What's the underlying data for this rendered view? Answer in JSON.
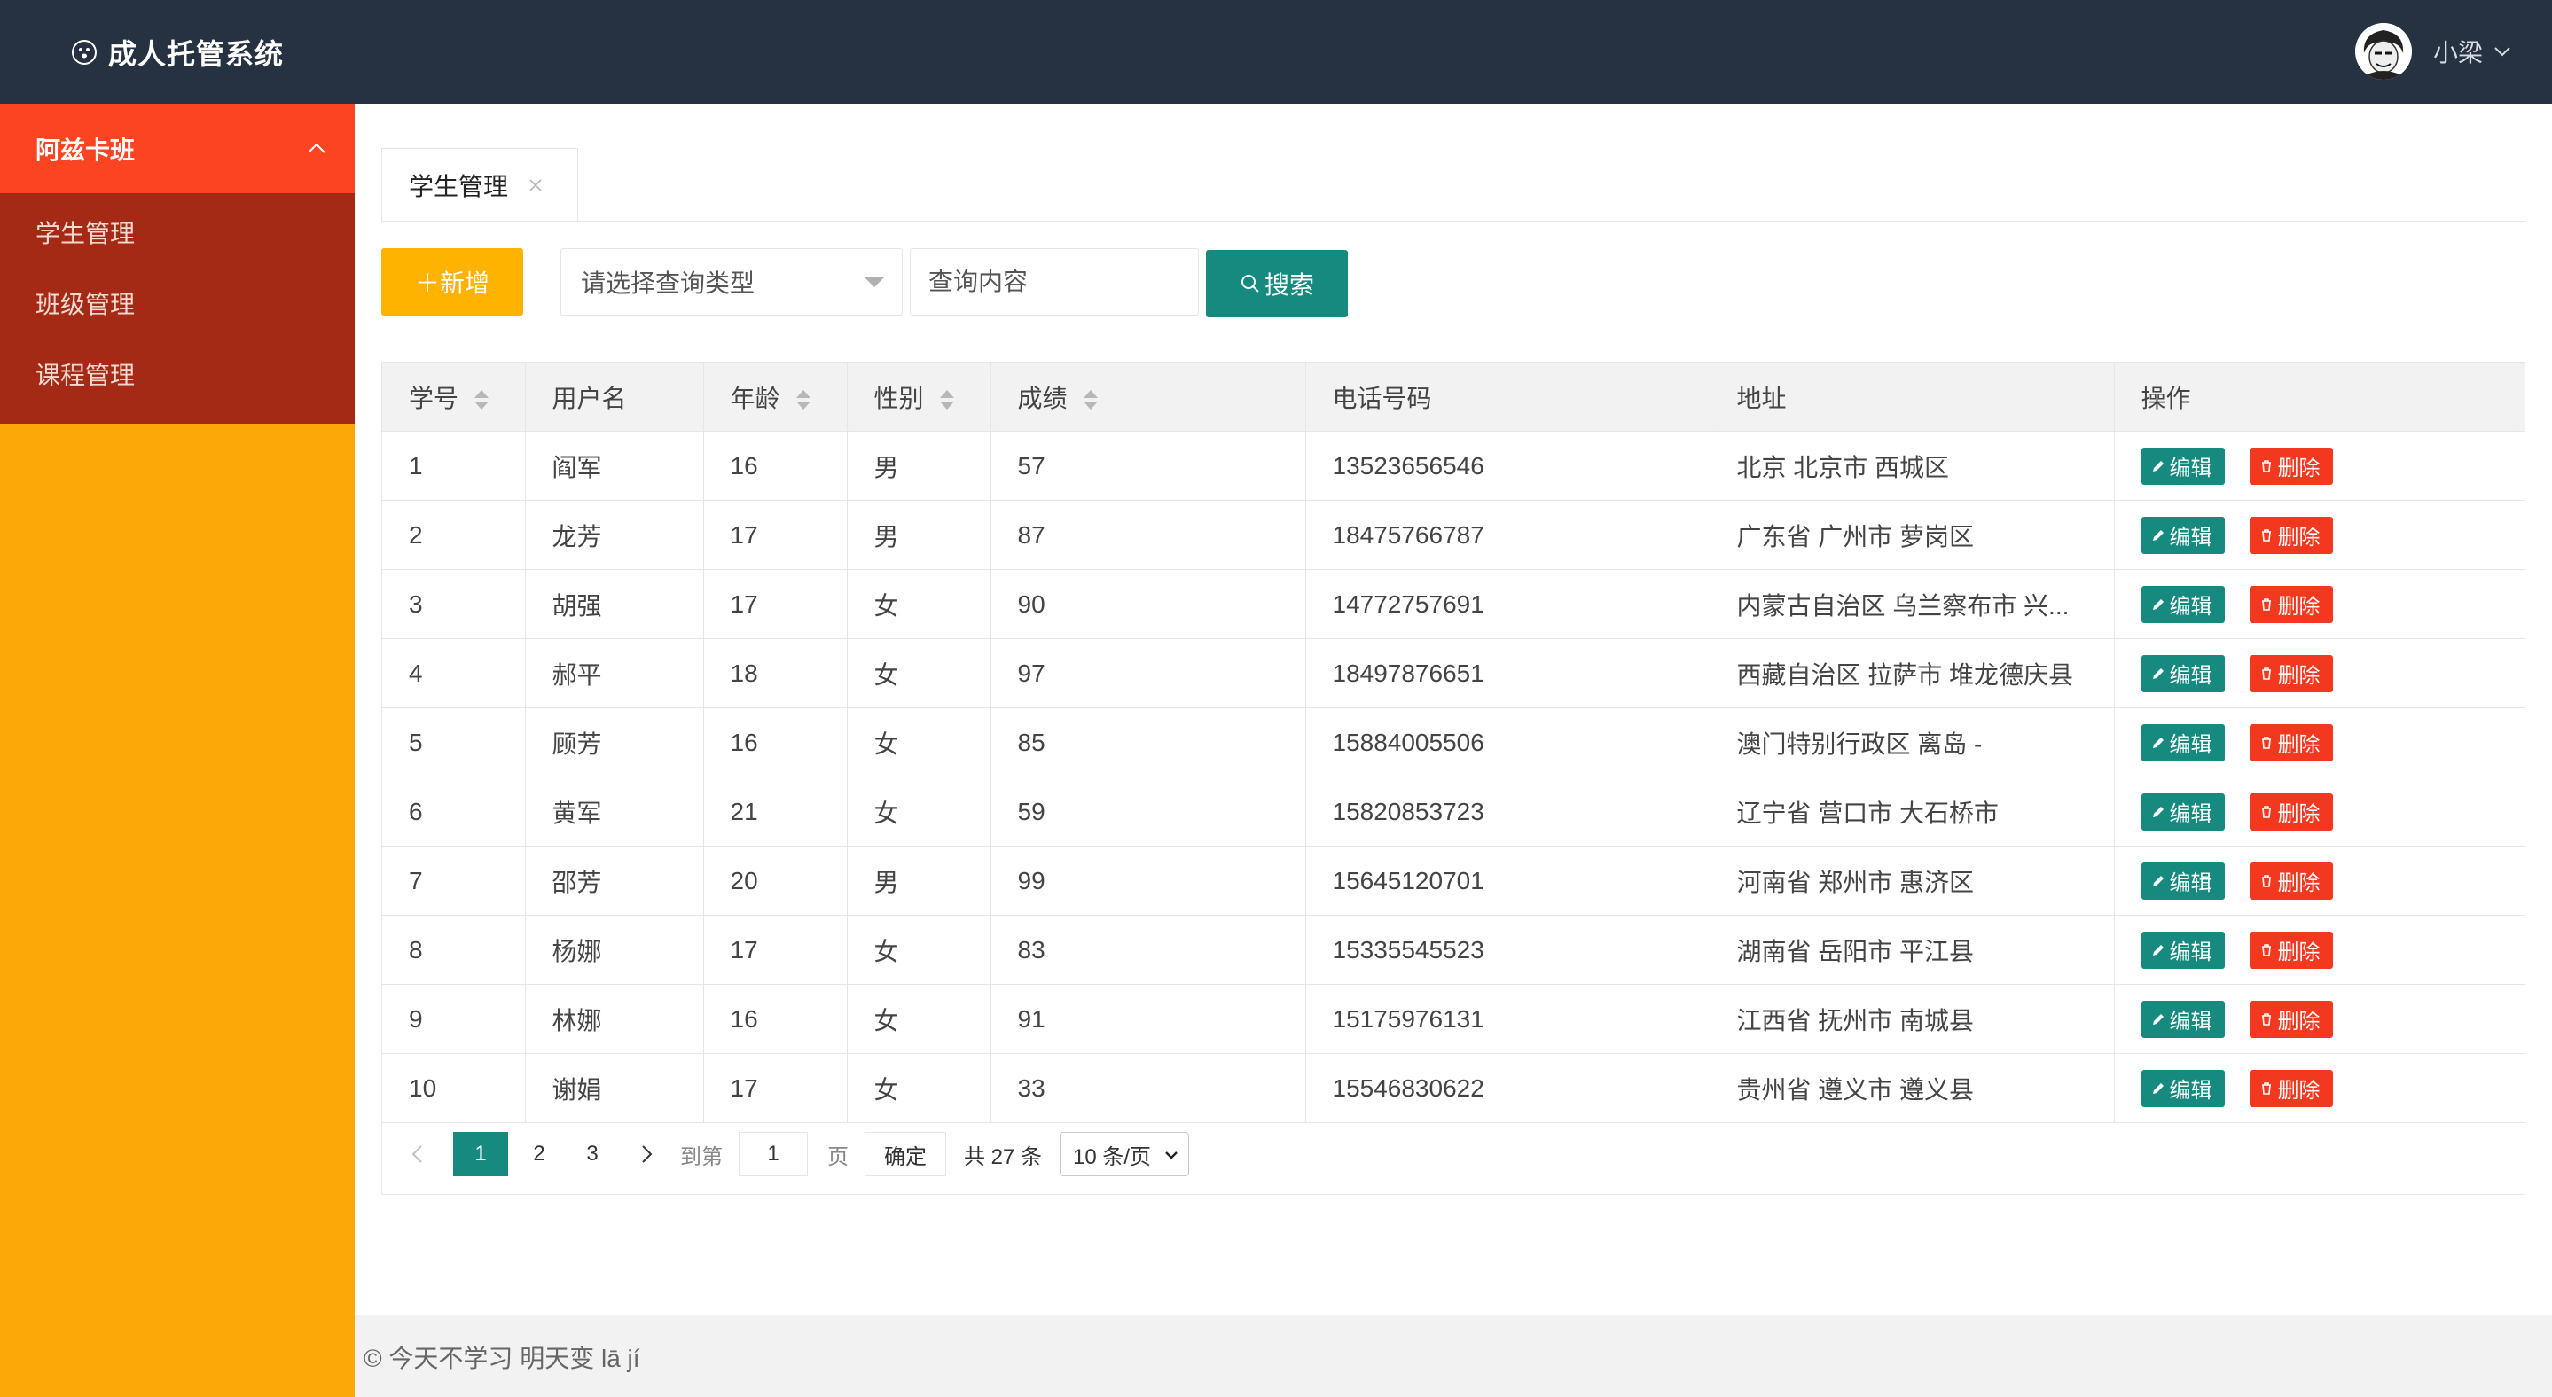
{
  "header": {
    "app_title": "成人托管系统",
    "user_name": "小梁",
    "logo_icon": "paw-icon",
    "bg_color": "#263142"
  },
  "sidebar": {
    "group_label": "阿兹卡班",
    "items": [
      {
        "label": "学生管理"
      },
      {
        "label": "班级管理"
      },
      {
        "label": "课程管理"
      }
    ],
    "accent_color": "#fb4422",
    "menu_bg": "#a52a16",
    "bg_color": "#fda809"
  },
  "tabs": [
    {
      "label": "学生管理"
    }
  ],
  "toolbar": {
    "add_label": "＋新增",
    "query_type_placeholder": "请选择查询类型",
    "query_input_placeholder": "查询内容",
    "search_label": "搜索"
  },
  "table": {
    "headers": [
      "学号",
      "用户名",
      "年龄",
      "性别",
      "成绩",
      "电话号码",
      "地址",
      "操作"
    ],
    "edit_label": "编辑",
    "delete_label": "删除",
    "rows": [
      {
        "id": "1",
        "name": "阎军",
        "age": "16",
        "gender": "男",
        "score": "57",
        "phone": "13523656546",
        "address": "北京 北京市 西城区"
      },
      {
        "id": "2",
        "name": "龙芳",
        "age": "17",
        "gender": "男",
        "score": "87",
        "phone": "18475766787",
        "address": "广东省 广州市 萝岗区"
      },
      {
        "id": "3",
        "name": "胡强",
        "age": "17",
        "gender": "女",
        "score": "90",
        "phone": "14772757691",
        "address": "内蒙古自治区 乌兰察布市 兴..."
      },
      {
        "id": "4",
        "name": "郝平",
        "age": "18",
        "gender": "女",
        "score": "97",
        "phone": "18497876651",
        "address": "西藏自治区 拉萨市 堆龙德庆县"
      },
      {
        "id": "5",
        "name": "顾芳",
        "age": "16",
        "gender": "女",
        "score": "85",
        "phone": "15884005506",
        "address": "澳门特别行政区 离岛 -"
      },
      {
        "id": "6",
        "name": "黄军",
        "age": "21",
        "gender": "女",
        "score": "59",
        "phone": "15820853723",
        "address": "辽宁省 营口市 大石桥市"
      },
      {
        "id": "7",
        "name": "邵芳",
        "age": "20",
        "gender": "男",
        "score": "99",
        "phone": "15645120701",
        "address": "河南省 郑州市 惠济区"
      },
      {
        "id": "8",
        "name": "杨娜",
        "age": "17",
        "gender": "女",
        "score": "83",
        "phone": "15335545523",
        "address": "湖南省 岳阳市 平江县"
      },
      {
        "id": "9",
        "name": "林娜",
        "age": "16",
        "gender": "女",
        "score": "91",
        "phone": "15175976131",
        "address": "江西省 抚州市 南城县"
      },
      {
        "id": "10",
        "name": "谢娟",
        "age": "17",
        "gender": "女",
        "score": "33",
        "phone": "15546830622",
        "address": "贵州省 遵义市 遵义县"
      }
    ]
  },
  "pagination": {
    "pages": [
      "1",
      "2",
      "3"
    ],
    "current_page": "1",
    "goto_label": "到第",
    "goto_value": "1",
    "page_unit": "页",
    "confirm_label": "确定",
    "total_label": "共 27 条",
    "page_size_label": "10 条/页"
  },
  "footer": {
    "text": "© 今天不学习 明天变 lā jí"
  },
  "colors": {
    "primary_green": "#178a7f",
    "add_yellow": "#fdb300",
    "delete_red": "#f2391f"
  }
}
